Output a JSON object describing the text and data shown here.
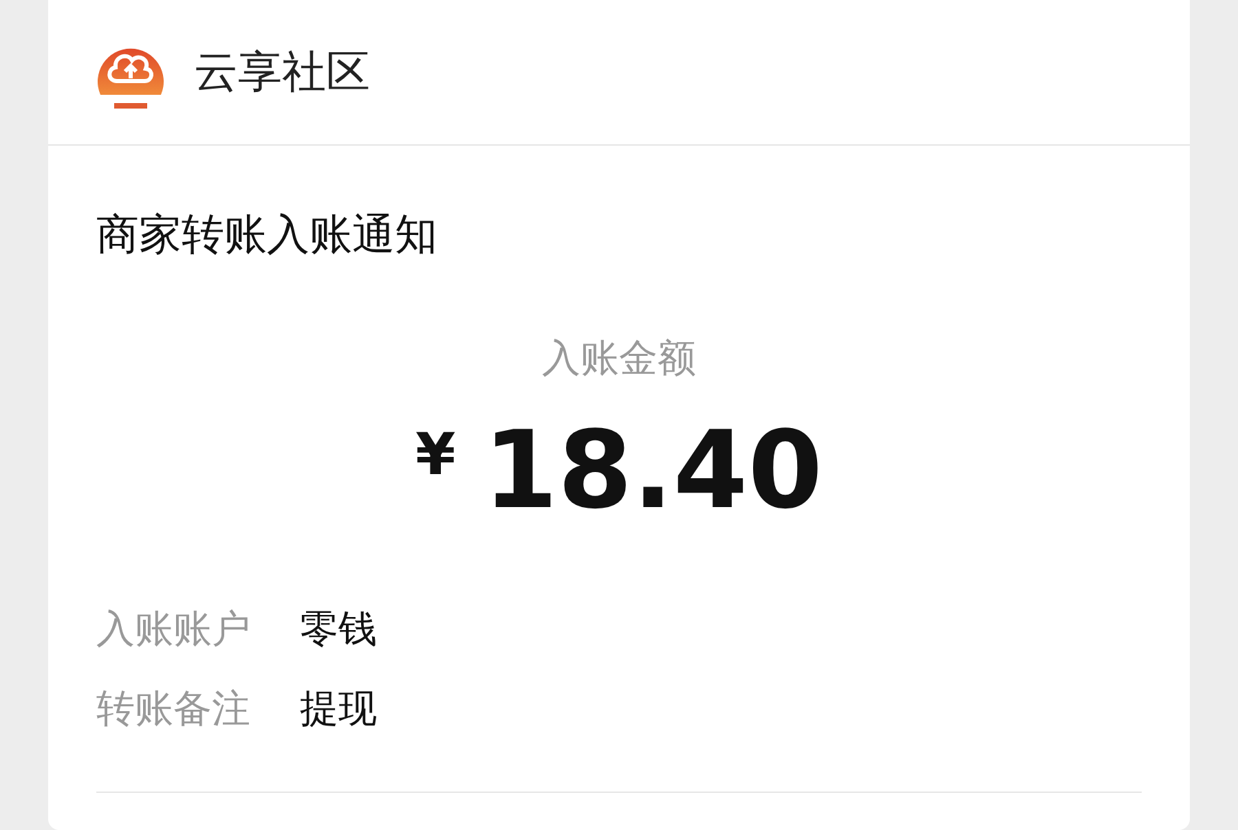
{
  "account": {
    "name": "云享社区"
  },
  "notice": {
    "title": "商家转账入账通知",
    "amount_label": "入账金额",
    "currency": "¥",
    "amount": "18.40",
    "details": [
      {
        "label": "入账账户",
        "value": "零钱"
      },
      {
        "label": "转账备注",
        "value": "提现"
      }
    ]
  }
}
